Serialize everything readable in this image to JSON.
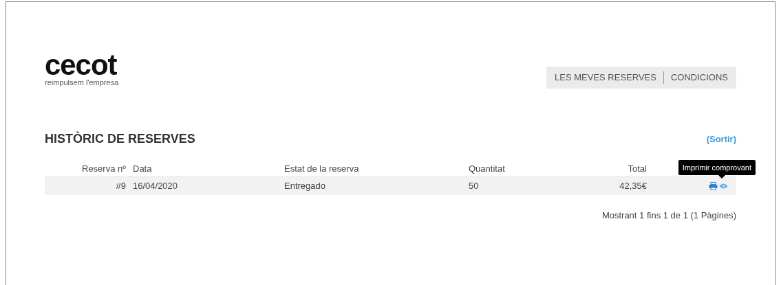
{
  "logo": {
    "name": "cecot",
    "tagline": "reimpulsem l'empresa"
  },
  "nav": {
    "items": [
      "LES MEVES RESERVES",
      "CONDICIONS"
    ]
  },
  "section": {
    "title": "HISTÒRIC DE RESERVES",
    "logout_link": "(Sortir)"
  },
  "table": {
    "columns": [
      "Reserva nº",
      "Data",
      "Estat de la reserva",
      "Quantitat",
      "Total"
    ],
    "rows": [
      {
        "cells": [
          "#9",
          "16/04/2020",
          "Entregado",
          "50",
          "42,35€"
        ]
      }
    ]
  },
  "tooltip": "Imprimir comprovant",
  "pagination": "Mostrant 1 fins 1 de 1 (1 Pàgines)"
}
